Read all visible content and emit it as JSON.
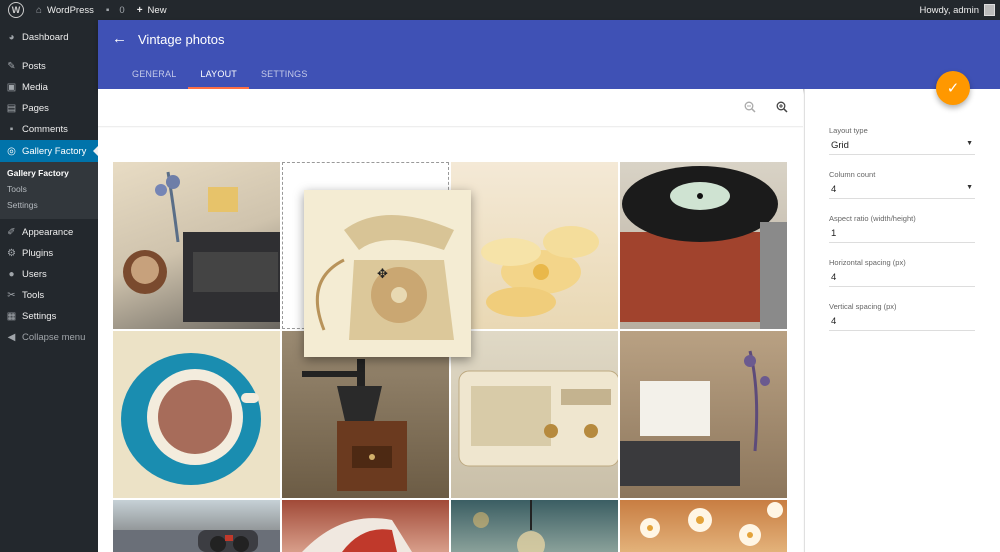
{
  "adminbar": {
    "site_name": "WordPress",
    "comments_count": "0",
    "new_label": "New",
    "howdy": "Howdy, admin"
  },
  "sidebar": {
    "items": [
      {
        "label": "Dashboard",
        "icon": "dashboard-icon"
      },
      {
        "label": "Posts",
        "icon": "pin-icon"
      },
      {
        "label": "Media",
        "icon": "media-icon"
      },
      {
        "label": "Pages",
        "icon": "pages-icon"
      },
      {
        "label": "Comments",
        "icon": "comment-icon"
      },
      {
        "label": "Gallery Factory",
        "icon": "gallery-icon"
      },
      {
        "label": "Appearance",
        "icon": "brush-icon"
      },
      {
        "label": "Plugins",
        "icon": "plugin-icon"
      },
      {
        "label": "Users",
        "icon": "users-icon"
      },
      {
        "label": "Tools",
        "icon": "wrench-icon"
      },
      {
        "label": "Settings",
        "icon": "settings-icon"
      }
    ],
    "submenu": [
      "Gallery Factory",
      "Tools",
      "Settings"
    ],
    "collapse_label": "Collapse menu"
  },
  "header": {
    "title": "Vintage photos",
    "tabs": [
      {
        "label": "GENERAL"
      },
      {
        "label": "LAYOUT"
      },
      {
        "label": "SETTINGS"
      }
    ]
  },
  "panel": {
    "layout_type": {
      "label": "Layout type",
      "value": "Grid"
    },
    "column_count": {
      "label": "Column count",
      "value": "4"
    },
    "aspect_ratio": {
      "label": "Aspect ratio (width/height)",
      "value": "1"
    },
    "horizontal_spacing": {
      "label": "Horizontal spacing (px)",
      "value": "4"
    },
    "vertical_spacing": {
      "label": "Vertical spacing (px)",
      "value": "4"
    }
  },
  "colors": {
    "accent": "#3f51b5",
    "tab_indicator": "#ff7043",
    "fab": "#ff9800",
    "wp_blue": "#0073aa"
  },
  "photos": [
    "typewriter-coffee-photo",
    "placeholder-slot",
    "yellow-flowers-photo",
    "record-player-photo",
    "coffee-cup-photo",
    "coffee-grinder-photo",
    "vintage-radio-photo",
    "typewriter-lavender-photo",
    "city-binoculars-photo",
    "sneakers-photo",
    "lightbulb-photo",
    "daisies-photo"
  ],
  "dragged_photo": "rotary-telephone-photo"
}
